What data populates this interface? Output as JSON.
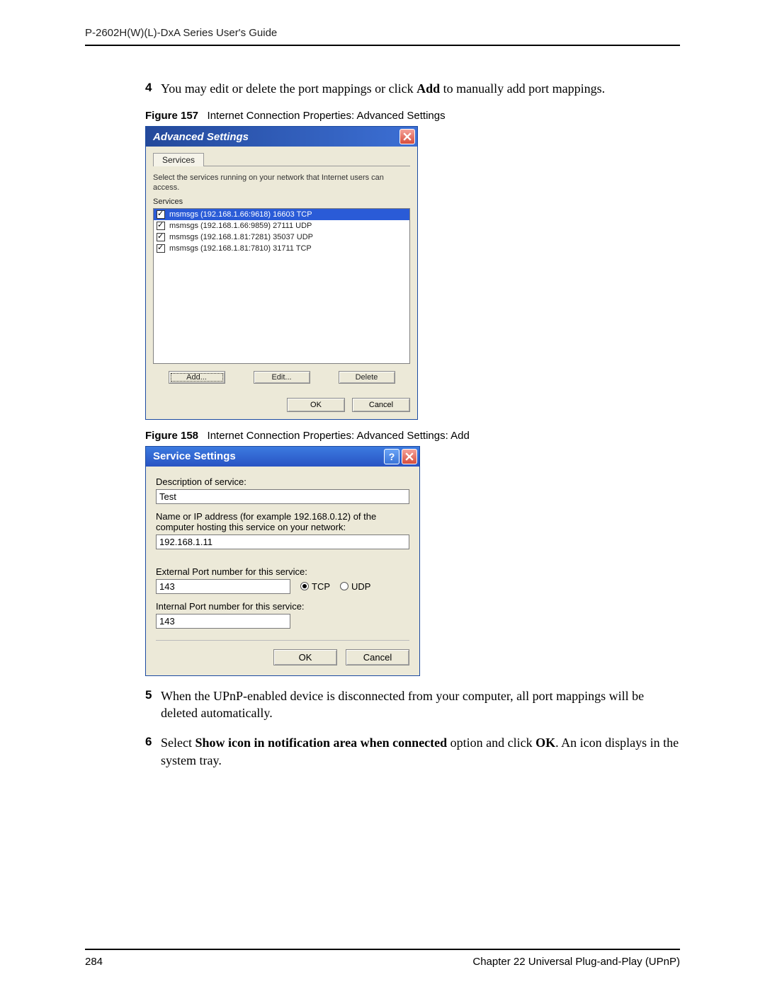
{
  "header": "P-2602H(W)(L)-DxA Series User's Guide",
  "step4": {
    "num": "4",
    "text_before": "You may edit or delete the port mappings or click ",
    "bold": "Add",
    "text_after": " to manually add port mappings."
  },
  "fig157": {
    "label": "Figure 157",
    "caption": "Internet Connection Properties: Advanced Settings"
  },
  "dialog1": {
    "title": "Advanced Settings",
    "tab": "Services",
    "instruction": "Select the services running on your network that Internet users can access.",
    "services_label": "Services",
    "services": [
      {
        "checked": true,
        "selected": true,
        "text": "msmsgs (192.168.1.66:9618) 16603 TCP"
      },
      {
        "checked": true,
        "selected": false,
        "text": "msmsgs (192.168.1.66:9859) 27111 UDP"
      },
      {
        "checked": true,
        "selected": false,
        "text": "msmsgs (192.168.1.81:7281) 35037 UDP"
      },
      {
        "checked": true,
        "selected": false,
        "text": "msmsgs (192.168.1.81:7810) 31711 TCP"
      }
    ],
    "add_btn": "Add...",
    "edit_btn": "Edit...",
    "delete_btn": "Delete",
    "ok_btn": "OK",
    "cancel_btn": "Cancel"
  },
  "fig158": {
    "label": "Figure 158",
    "caption": "Internet Connection Properties: Advanced Settings: Add"
  },
  "dialog2": {
    "title": "Service Settings",
    "desc_label": "Description of service:",
    "desc_value": "Test",
    "host_label": "Name or IP address (for example 192.168.0.12) of the computer hosting this service on your network:",
    "host_value": "192.168.1.11",
    "ext_label": "External Port number for this service:",
    "ext_value": "143",
    "tcp_label": "TCP",
    "udp_label": "UDP",
    "int_label": "Internal Port number for this service:",
    "int_value": "143",
    "ok_btn": "OK",
    "cancel_btn": "Cancel",
    "help_glyph": "?"
  },
  "step5": {
    "num": "5",
    "text": "When the UPnP-enabled device is disconnected from your computer, all port mappings will be deleted automatically."
  },
  "step6": {
    "num": "6",
    "before": "Select ",
    "bold1": "Show icon in notification area when connected",
    "mid": " option and click ",
    "bold2": "OK",
    "after": ". An icon displays in the system tray."
  },
  "footer": {
    "page": "284",
    "chapter": "Chapter 22 Universal Plug-and-Play (UPnP)"
  }
}
